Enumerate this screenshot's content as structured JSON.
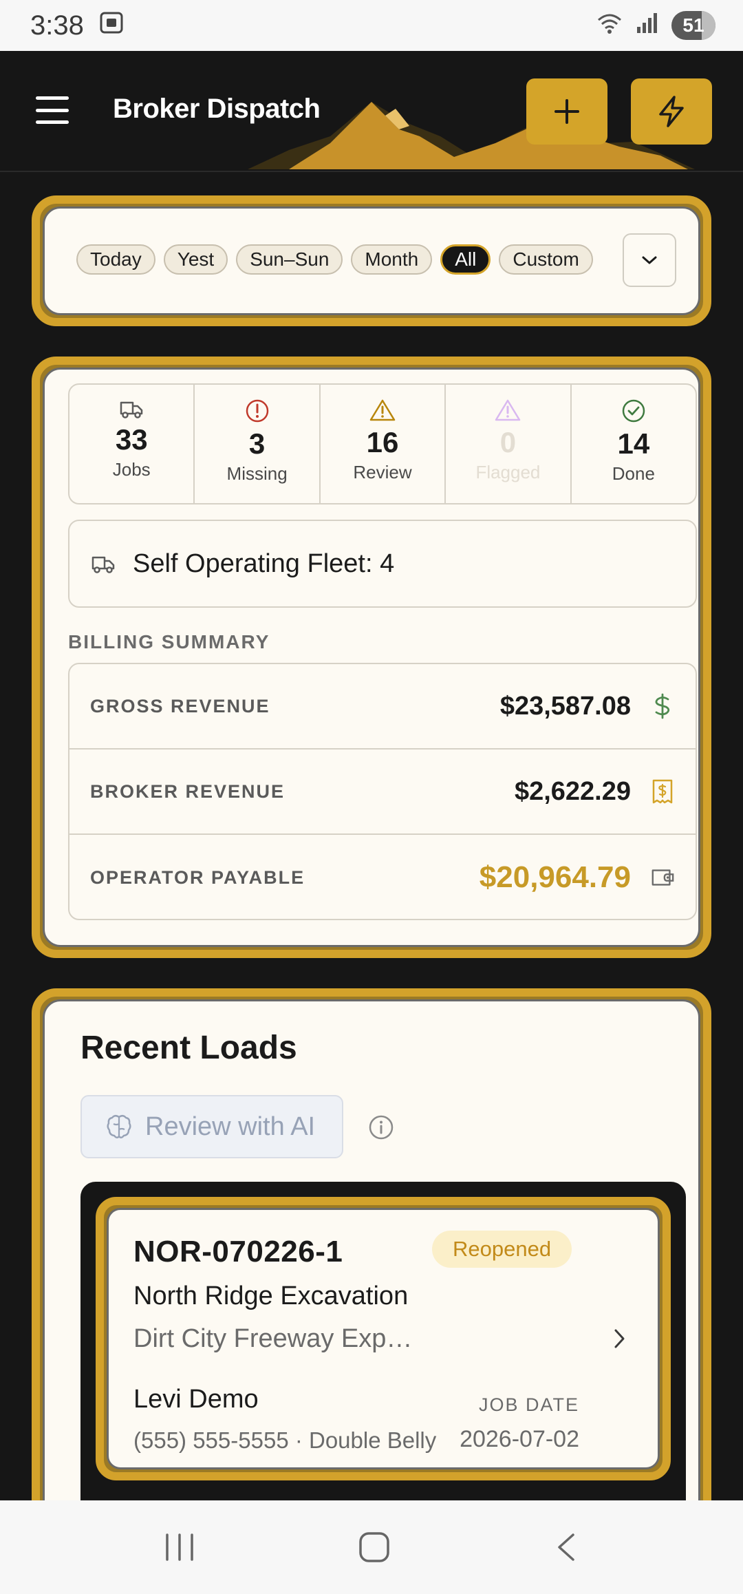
{
  "status_bar": {
    "time": "3:38",
    "battery": "51"
  },
  "header": {
    "title": "Broker Dispatch"
  },
  "filters": {
    "chips": [
      "Today",
      "Yest",
      "Sun–Sun",
      "Month",
      "All",
      "Custom"
    ],
    "active": "All"
  },
  "stats": [
    {
      "value": "33",
      "label": "Jobs",
      "icon": "truck-icon",
      "color": "#5b5b5b"
    },
    {
      "value": "3",
      "label": "Missing",
      "icon": "alert-circle-icon",
      "color": "#c0392b"
    },
    {
      "value": "16",
      "label": "Review",
      "icon": "warning-icon",
      "color": "#b8860b"
    },
    {
      "value": "0",
      "label": "Flagged",
      "icon": "warning-icon",
      "color": "#d9b8f0"
    },
    {
      "value": "14",
      "label": "Done",
      "icon": "check-circle-icon",
      "color": "#3f7a3f"
    }
  ],
  "fleet": {
    "text": "Self Operating Fleet: 4"
  },
  "billing": {
    "title": "BILLING SUMMARY",
    "rows": [
      {
        "label": "GROSS REVENUE",
        "value": "$23,587.08",
        "icon": "dollar-icon"
      },
      {
        "label": "BROKER REVENUE",
        "value": "$2,622.29",
        "icon": "receipt-icon"
      },
      {
        "label": "OPERATOR PAYABLE",
        "value": "$20,964.79",
        "icon": "wallet-icon"
      }
    ]
  },
  "recent": {
    "title": "Recent Loads",
    "ai_button": "Review with AI",
    "loads": [
      {
        "id": "NOR-070226-1",
        "status": "Reopened",
        "company": "North Ridge Excavation",
        "route": "Dirt City Freeway Exp…",
        "driver": "Levi Demo",
        "contact": "(555) 555-5555 · Double Belly",
        "job_date_label": "JOB DATE",
        "job_date": "2026-07-02"
      }
    ]
  },
  "colors": {
    "accent": "#d4a429",
    "background": "#161616",
    "card": "#fdfaf3",
    "gold_text": "#c79a27"
  }
}
